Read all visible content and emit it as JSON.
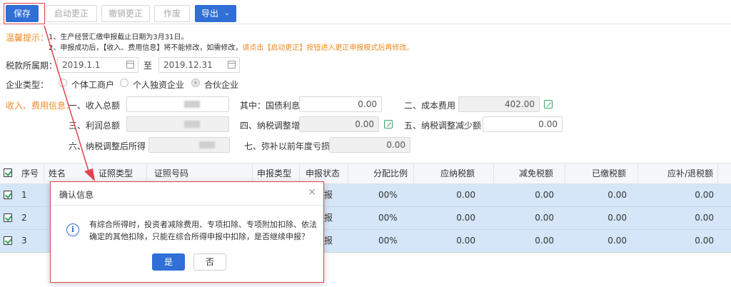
{
  "toolbar": {
    "save": "保存",
    "start_correction": "启动更正",
    "cancel_correction": "撤销更正",
    "void": "作废",
    "export": "导出"
  },
  "notice": {
    "label": "温馨提示：",
    "line1": "1、生产经营汇缴申报截止日期为3月31日。",
    "line2_prefix": "2、申报成功后，【收入、费用信息】将不能修改，如需修改，",
    "line2_highlight": "请点击【启动更正】按钮进入更正申报模式后再修改。"
  },
  "period": {
    "label": "税款所属期：",
    "start": "2019.1.1",
    "to": "至",
    "end": "2019.12.31"
  },
  "enterprise_type": {
    "label": "企业类型：",
    "options": [
      "个体工商户",
      "个人独资企业",
      "合伙企业"
    ],
    "selected": "合伙企业"
  },
  "income": {
    "section_label": "收入、费用信息：",
    "total_income_label": "一、收入总额",
    "treasury_interest_label": "其中：国债利息收入",
    "treasury_interest_value": "0.00",
    "cost_label": "二、成本费用",
    "cost_value": "402.00",
    "total_profit_label": "三、利润总额",
    "tax_adj_increase_label": "四、纳税调整增加额",
    "tax_adj_increase_value": "0.00",
    "tax_adj_decrease_label": "五、纳税调整减少额",
    "tax_adj_decrease_value": "0.00",
    "income_after_adj_label": "六、纳税调整后所得",
    "prior_loss_label": "七、弥补以前年度亏损",
    "prior_loss_value": "0.00"
  },
  "table": {
    "headers": [
      "序号",
      "姓名",
      "证照类型",
      "证照号码",
      "申报类型",
      "申报状态",
      "分配比例",
      "应纳税额",
      "减免税额",
      "已缴税额",
      "应补/退税额"
    ],
    "rows": [
      {
        "no": "1",
        "status": "报",
        "ratio": "00%",
        "tax_due": "0.00",
        "reduction": "0.00",
        "paid": "0.00",
        "refund": "0.00"
      },
      {
        "no": "2",
        "status": "报",
        "ratio": "00%",
        "tax_due": "0.00",
        "reduction": "0.00",
        "paid": "0.00",
        "refund": "0.00"
      },
      {
        "no": "3",
        "status": "报",
        "ratio": "00%",
        "tax_due": "0.00",
        "reduction": "0.00",
        "paid": "0.00",
        "refund": "0.00"
      }
    ]
  },
  "dialog": {
    "title": "确认信息",
    "close": "×",
    "message": "有综合所得时，投资者减除费用、专项扣除、专项附加扣除、依法确定的其他扣除，只能在综合所得申报中扣除，是否继续申报？",
    "yes": "是",
    "no": "否"
  },
  "colors": {
    "primary": "#2f6fd6",
    "highlight": "#f08a24",
    "annotation_red": "#e0444e",
    "row_selected": "#d4e6f7"
  }
}
